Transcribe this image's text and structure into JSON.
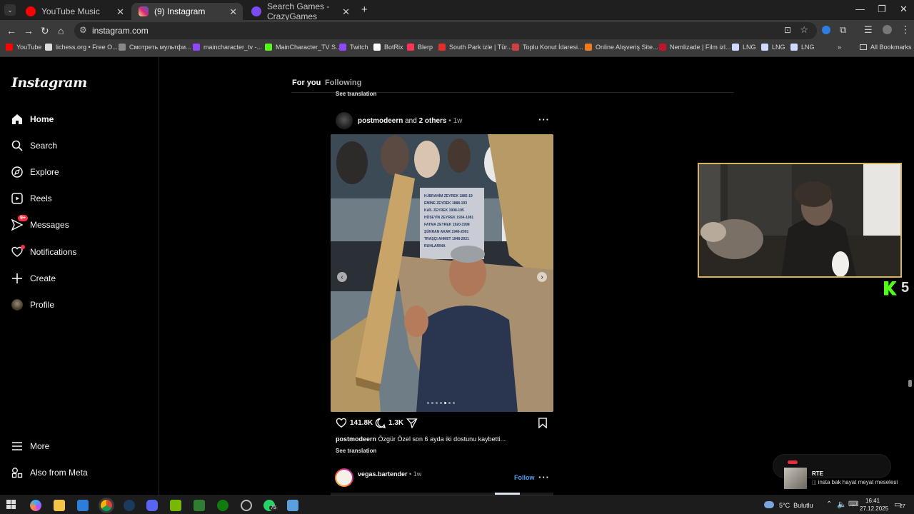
{
  "browser": {
    "tabs": [
      {
        "title": "YouTube Music",
        "active": false,
        "color": "#ff0000"
      },
      {
        "title": "(9) Instagram",
        "active": true,
        "color": "#d62976"
      },
      {
        "title": "Search Games - CrazyGames",
        "active": false,
        "color": "#7a4df0"
      }
    ],
    "new_tab": "+",
    "address": "instagram.com",
    "bookmarks": [
      {
        "label": "YouTube",
        "color": "#ff0000"
      },
      {
        "label": "lichess.org • Free O...",
        "color": "#dddddd"
      },
      {
        "label": "Смотреть мультфи...",
        "color": "#888888"
      },
      {
        "label": "maincharacter_tv -...",
        "color": "#9146ff"
      },
      {
        "label": "MainCharacter_TV S...",
        "color": "#53fc18"
      },
      {
        "label": "Twitch",
        "color": "#9146ff"
      },
      {
        "label": "BotRix",
        "color": "#ffffff"
      },
      {
        "label": "Blerp",
        "color": "#ff3355"
      },
      {
        "label": "South Park izle | Tür...",
        "color": "#e0302e"
      },
      {
        "label": "Toplu Konut İdaresi...",
        "color": "#d04040"
      },
      {
        "label": "Online Alışveriş Site...",
        "color": "#f27a1a"
      },
      {
        "label": "Nemlizade | Film izl...",
        "color": "#c0142d"
      },
      {
        "label": "LNG",
        "color": "#cfd8ff"
      },
      {
        "label": "LNG",
        "color": "#cfd8ff"
      },
      {
        "label": "LNG",
        "color": "#cfd8ff"
      }
    ],
    "bookmarks_more": "»",
    "all_bookmarks": "All Bookmarks"
  },
  "instagram": {
    "logo": "Instagram",
    "nav": [
      {
        "label": "Home",
        "icon": "home-icon",
        "bold": true
      },
      {
        "label": "Search",
        "icon": "search-icon"
      },
      {
        "label": "Explore",
        "icon": "explore-icon"
      },
      {
        "label": "Reels",
        "icon": "reels-icon"
      },
      {
        "label": "Messages",
        "icon": "messages-icon",
        "badge": "9+"
      },
      {
        "label": "Notifications",
        "icon": "heart-icon"
      },
      {
        "label": "Create",
        "icon": "plus-icon"
      },
      {
        "label": "Profile",
        "icon": "avatar"
      }
    ],
    "more": "More",
    "also_from_meta": "Also from Meta",
    "feed_tabs": {
      "for_you": "For you",
      "following": "Following"
    },
    "prev_see_translation": "See translation",
    "post": {
      "author": "postmodeern",
      "and_others": "and",
      "others_count": "2 others",
      "age": "1w",
      "likes": "141.8K",
      "comments": "1.3K",
      "caption_author": "postmodeern",
      "caption": "Özgür Özel son 6 ayda iki dostunu kaybetti...",
      "see_translation": "See translation",
      "carousel_active_index": 4,
      "carousel_count": 7,
      "tombstone_lines": [
        "H.İBRAHİM ZEYREK 1885-19",
        "EMİNE ZEYREK 1888-193",
        "KAİL ZEYREK 1908-195",
        "HÜSEYİN ZEYREK 1934-1981",
        "FATMA ZEYREK 1920-1998",
        "ŞÜKRAN AKAR 1946-2001",
        "TRAŞÇI AHMET 1948-2021",
        "RUHLARINA"
      ]
    },
    "next_post": {
      "author": "vegas.bartender",
      "age": "1w",
      "follow": "Follow"
    }
  },
  "stream": {
    "kick_count": "5"
  },
  "chat_notif": {
    "user": "RTE",
    "message": "insta bak hayat meyat meselesi"
  },
  "taskbar": {
    "weather": "5°C  Bulutlu",
    "time": "16:41",
    "date": "27.12.2025",
    "notification_count": "27",
    "steam_badge": "75"
  }
}
